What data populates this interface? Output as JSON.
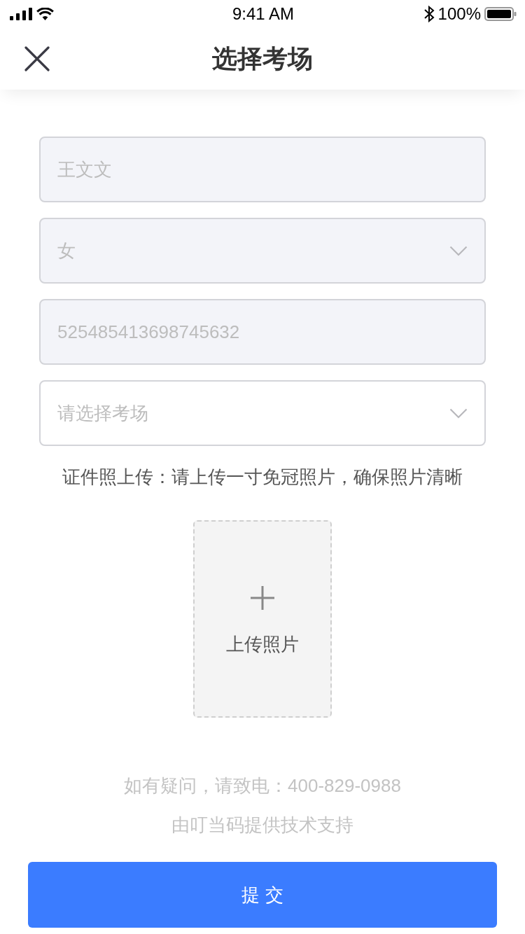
{
  "status_bar": {
    "time": "9:41 AM",
    "battery": "100%"
  },
  "nav": {
    "title": "选择考场"
  },
  "fields": [
    {
      "kind": "text",
      "value": "王文文",
      "disabled": true
    },
    {
      "kind": "select",
      "value": "女",
      "disabled": true
    },
    {
      "kind": "text",
      "value": "525485413698745632",
      "disabled": true
    },
    {
      "kind": "select",
      "placeholder": "请选择考场",
      "disabled": false
    }
  ],
  "upload": {
    "note": "证件照上传：请上传一寸免冠照片，确保照片清晰",
    "label": "上传照片"
  },
  "footer": {
    "contact": "如有疑问，请致电：400-829-0988",
    "credit": "由叮当码提供技术支持"
  },
  "submit": {
    "label": "提 交"
  }
}
